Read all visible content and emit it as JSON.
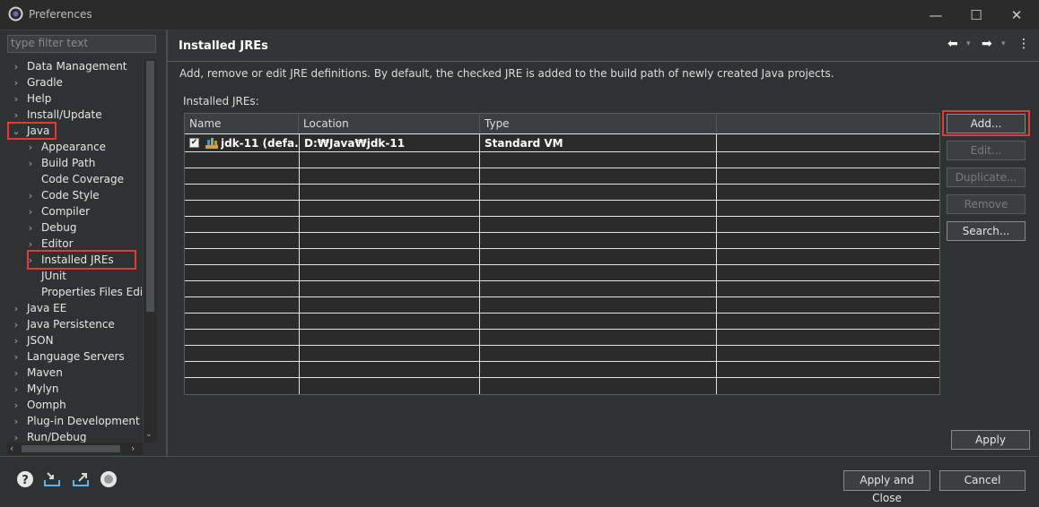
{
  "window": {
    "title": "Preferences",
    "min_glyph": "—",
    "max_glyph": "☐",
    "close_glyph": "✕"
  },
  "filter": {
    "placeholder": "type filter text"
  },
  "tree": [
    {
      "label": "Data Management",
      "level": 0,
      "expander": "collapsed"
    },
    {
      "label": "Gradle",
      "level": 0,
      "expander": "collapsed"
    },
    {
      "label": "Help",
      "level": 0,
      "expander": "collapsed"
    },
    {
      "label": "Install/Update",
      "level": 0,
      "expander": "collapsed"
    },
    {
      "label": "Java",
      "level": 0,
      "expander": "expanded"
    },
    {
      "label": "Appearance",
      "level": 1,
      "expander": "collapsed"
    },
    {
      "label": "Build Path",
      "level": 1,
      "expander": "collapsed"
    },
    {
      "label": "Code Coverage",
      "level": 1,
      "expander": "none"
    },
    {
      "label": "Code Style",
      "level": 1,
      "expander": "collapsed"
    },
    {
      "label": "Compiler",
      "level": 1,
      "expander": "collapsed"
    },
    {
      "label": "Debug",
      "level": 1,
      "expander": "collapsed"
    },
    {
      "label": "Editor",
      "level": 1,
      "expander": "collapsed"
    },
    {
      "label": "Installed JREs",
      "level": 1,
      "expander": "collapsed"
    },
    {
      "label": "JUnit",
      "level": 1,
      "expander": "none"
    },
    {
      "label": "Properties Files Edito",
      "level": 1,
      "expander": "none"
    },
    {
      "label": "Java EE",
      "level": 0,
      "expander": "collapsed"
    },
    {
      "label": "Java Persistence",
      "level": 0,
      "expander": "collapsed"
    },
    {
      "label": "JSON",
      "level": 0,
      "expander": "collapsed"
    },
    {
      "label": "Language Servers",
      "level": 0,
      "expander": "collapsed"
    },
    {
      "label": "Maven",
      "level": 0,
      "expander": "collapsed"
    },
    {
      "label": "Mylyn",
      "level": 0,
      "expander": "collapsed"
    },
    {
      "label": "Oomph",
      "level": 0,
      "expander": "collapsed"
    },
    {
      "label": "Plug-in Development",
      "level": 0,
      "expander": "collapsed"
    },
    {
      "label": "Run/Debug",
      "level": 0,
      "expander": "collapsed"
    }
  ],
  "page": {
    "title": "Installed JREs",
    "description": "Add, remove or edit JRE definitions. By default, the checked JRE is added to the build path of newly created Java projects.",
    "list_label": "Installed JREs:"
  },
  "table": {
    "columns": [
      "Name",
      "Location",
      "Type",
      ""
    ],
    "rows": [
      {
        "checked": true,
        "name": "jdk-11 (defa...",
        "location": "D:₩Java₩jdk-11",
        "type": "Standard VM"
      }
    ],
    "empty_rows": 14
  },
  "buttons": {
    "add": "Add...",
    "edit": "Edit...",
    "duplicate": "Duplicate...",
    "remove": "Remove",
    "search": "Search...",
    "apply": "Apply",
    "apply_close": "Apply and Close",
    "cancel": "Cancel"
  },
  "colors": {
    "highlight": "#e53935",
    "background": "#2f3233",
    "table_grid": "#e4e4e4"
  }
}
